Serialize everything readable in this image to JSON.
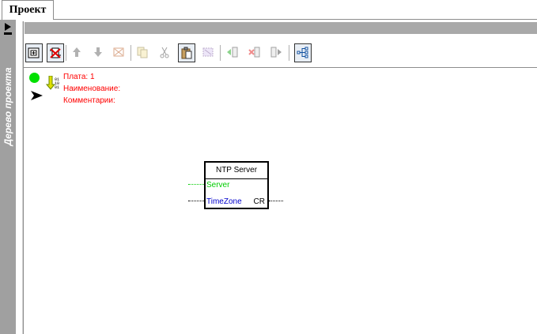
{
  "tabs": [
    {
      "label": "Проект"
    }
  ],
  "sidebar": {
    "label": "Дерево проекта",
    "toggle_icon": "play-pin-icon"
  },
  "toolbar": {
    "buttons": [
      {
        "name": "add-block",
        "icon": "add-block-icon"
      },
      {
        "name": "delete-block",
        "icon": "delete-block-icon"
      },
      {
        "name": "move-up",
        "icon": "arrow-up-icon"
      },
      {
        "name": "move-down",
        "icon": "arrow-down-icon"
      },
      {
        "name": "cut-disabled",
        "icon": "cut-block-icon"
      },
      {
        "name": "copy",
        "icon": "copy-icon"
      },
      {
        "name": "scissors",
        "icon": "scissors-icon"
      },
      {
        "name": "paste",
        "icon": "paste-icon"
      },
      {
        "name": "select",
        "icon": "select-icon"
      },
      {
        "name": "insert-left",
        "icon": "insert-left-icon"
      },
      {
        "name": "remove-left",
        "icon": "remove-left-icon"
      },
      {
        "name": "insert-right",
        "icon": "insert-right-icon"
      },
      {
        "name": "tree-view",
        "icon": "tree-view-icon"
      }
    ]
  },
  "info": {
    "board": "Плата: 1",
    "name": "Наименование:",
    "comment": "Комментарии:",
    "status_color": "#00e000",
    "text_color": "#ff0000"
  },
  "block": {
    "title": "NTP Server",
    "inputs": [
      {
        "label": "Server",
        "color": "#00cc00"
      },
      {
        "label": "TimeZone",
        "color": "#0000cc"
      }
    ],
    "outputs": [
      {
        "label": "CR"
      }
    ]
  }
}
